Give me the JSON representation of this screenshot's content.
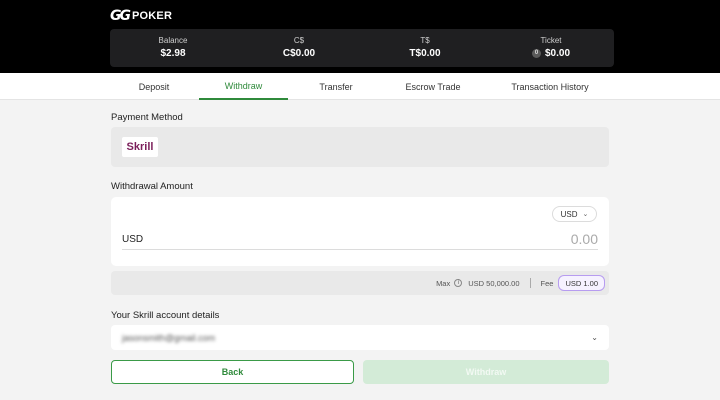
{
  "brand": {
    "mark": "GG",
    "name": "POKER"
  },
  "balances": [
    {
      "label": "Balance",
      "value": "$2.98"
    },
    {
      "label": "C$",
      "value": "C$0.00"
    },
    {
      "label": "T$",
      "value": "T$0.00"
    },
    {
      "label": "Ticket",
      "value": "$0.00",
      "icon": "ticket-icon",
      "icon_glyph": "0"
    }
  ],
  "tabs": [
    {
      "label": "Deposit",
      "active": false
    },
    {
      "label": "Withdraw",
      "active": true
    },
    {
      "label": "Transfer",
      "active": false
    },
    {
      "label": "Escrow Trade",
      "active": false
    },
    {
      "label": "Transaction History",
      "active": false
    }
  ],
  "payment_method": {
    "title": "Payment Method",
    "selected": "Skrill"
  },
  "withdrawal": {
    "title": "Withdrawal Amount",
    "currency_select": "USD",
    "currency_label": "USD",
    "amount": "0.00"
  },
  "limits": {
    "max_label": "Max",
    "max_value": "USD 50,000.00",
    "fee_label": "Fee",
    "fee_value": "USD 1.00"
  },
  "account": {
    "title": "Your Skrill account details",
    "email": "jasonsmith@gmail.com"
  },
  "buttons": {
    "back": "Back",
    "withdraw": "Withdraw"
  },
  "colors": {
    "accent": "#2f8a3b",
    "header_bg": "#000000",
    "fee_outline": "#b79cf0"
  }
}
